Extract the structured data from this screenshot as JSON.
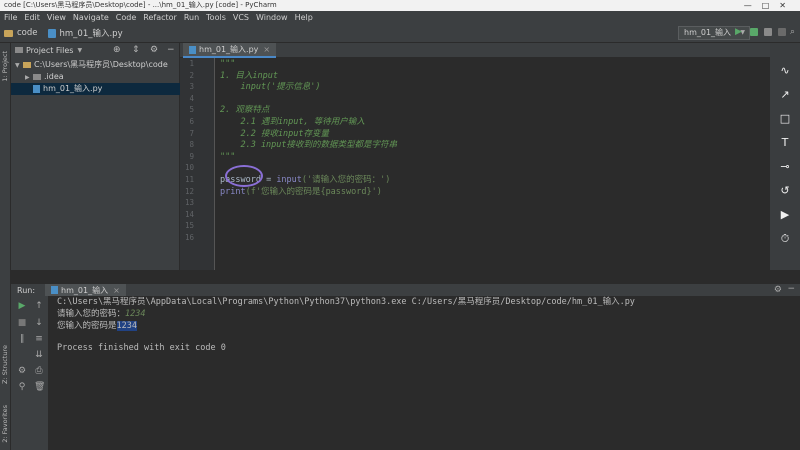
{
  "window": {
    "title": "code [C:\\Users\\黑马程序员\\Desktop\\code] - ...\\hm_01_输入.py [code] - PyCharm",
    "controls": [
      "—",
      "□",
      "✕"
    ]
  },
  "menu": [
    "File",
    "Edit",
    "View",
    "Navigate",
    "Code",
    "Refactor",
    "Run",
    "Tools",
    "VCS",
    "Window",
    "Help"
  ],
  "breadcrumbs": [
    "code",
    "hm_01_输入.py"
  ],
  "run_config": "hm_01_输入",
  "left_tool_tabs": [
    "1: Project",
    "Z: Structure",
    "2: Favorites"
  ],
  "project_panel": {
    "title": "Project Files",
    "tree": [
      {
        "label": "C:\\Users\\黑马程序员\\Desktop\\code",
        "type": "folder",
        "expanded": true
      },
      {
        "label": ".idea",
        "type": "folder-gray",
        "expanded": false
      },
      {
        "label": "hm_01_输入.py",
        "type": "py",
        "selected": true
      }
    ]
  },
  "editor": {
    "tab_label": "hm_01_输入.py",
    "line_numbers": [
      "1",
      "2",
      "3",
      "4",
      "5",
      "6",
      "7",
      "8",
      "9",
      "10",
      "11",
      "12",
      "13",
      "14",
      "15",
      "16"
    ],
    "lines": {
      "l1": "\"\"\"",
      "l2": "1. 目入input",
      "l3": "    input('提示信息')",
      "l5": "2. 观察特点",
      "l6": "    2.1 遇到input, 等待用户输入",
      "l7": "    2.2 接收input存变量",
      "l8": "    2.3 input接收到的数据类型都是字符串",
      "l9": "\"\"\"",
      "l11_a": "password",
      "l11_b": " = ",
      "l11_c": "input",
      "l11_d": "('请输入您的密码：')",
      "l12_a": "print",
      "l12_b": "(f'您输入的密码是{password}')"
    }
  },
  "run_panel": {
    "label": "Run:",
    "tab": "hm_01_输入",
    "console": {
      "cmd": "C:\\Users\\黑马程序员\\AppData\\Local\\Programs\\Python\\Python37\\python3.exe C:/Users/黑马程序员/Desktop/code/hm_01_输入.py",
      "prompt": "请输入您的密码：",
      "input": "1234",
      "output_prefix": "您输入的密码是",
      "output_value": "1234",
      "exit": "Process finished with exit code 0"
    }
  },
  "colors": {
    "editor_bg": "#2b2b2b",
    "panel_bg": "#3c3f41",
    "docstring": "#629755",
    "selection": "#214283",
    "annotation": "#8a6fd6"
  }
}
